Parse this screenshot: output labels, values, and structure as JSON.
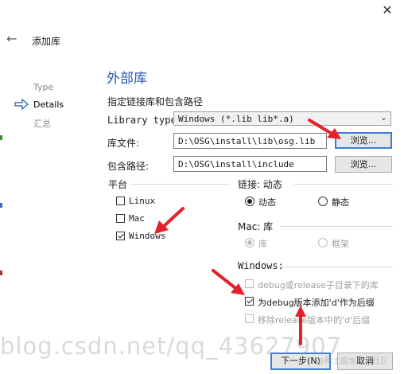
{
  "window": {
    "close_glyph": "✕",
    "back_glyph": "←",
    "title": "添加库"
  },
  "steps": [
    {
      "label": "Type"
    },
    {
      "label": "Details"
    },
    {
      "label": "汇总"
    }
  ],
  "page": {
    "title": "外部库",
    "subtitle": "指定链接库和包含路径",
    "library_type_label": "Library type:",
    "library_type_value": "Windows (*.lib lib*.a)",
    "library_file_label": "库文件:",
    "library_file_value": "D:\\OSG\\install\\lib\\osg.lib",
    "include_path_label": "包含路径:",
    "include_path_value": "D:\\OSG\\install\\include",
    "browse_label": "浏览..."
  },
  "platform": {
    "label": "平台",
    "linux": "Linux",
    "mac": "Mac",
    "windows": "Windows"
  },
  "linkage": {
    "label": "链接: 动态",
    "dynamic": "动态",
    "static": "静态"
  },
  "mac_lib": {
    "label": "Mac: 库",
    "library": "库",
    "framework": "框架"
  },
  "windows_opts": {
    "label": "Windows:",
    "subdir": "debug或release子目录下的库",
    "add_d": "为debug版本添加'd'作为后缀",
    "remove_d": "移除release版本中的'd'后缀"
  },
  "footer": {
    "next": "下一步(N)",
    "cancel": "取消"
  },
  "watermark": {
    "text": "blog.csdn.net/qq_43627907",
    "small": "@稀土掘金技术社区"
  },
  "colors": {
    "accent": "#2457b8",
    "focus": "#3a7fd6",
    "annotation_arrow": "#e8202a"
  },
  "icons": {
    "step_current": "arrow-right-icon",
    "back": "arrow-left-icon",
    "close": "close-icon"
  }
}
